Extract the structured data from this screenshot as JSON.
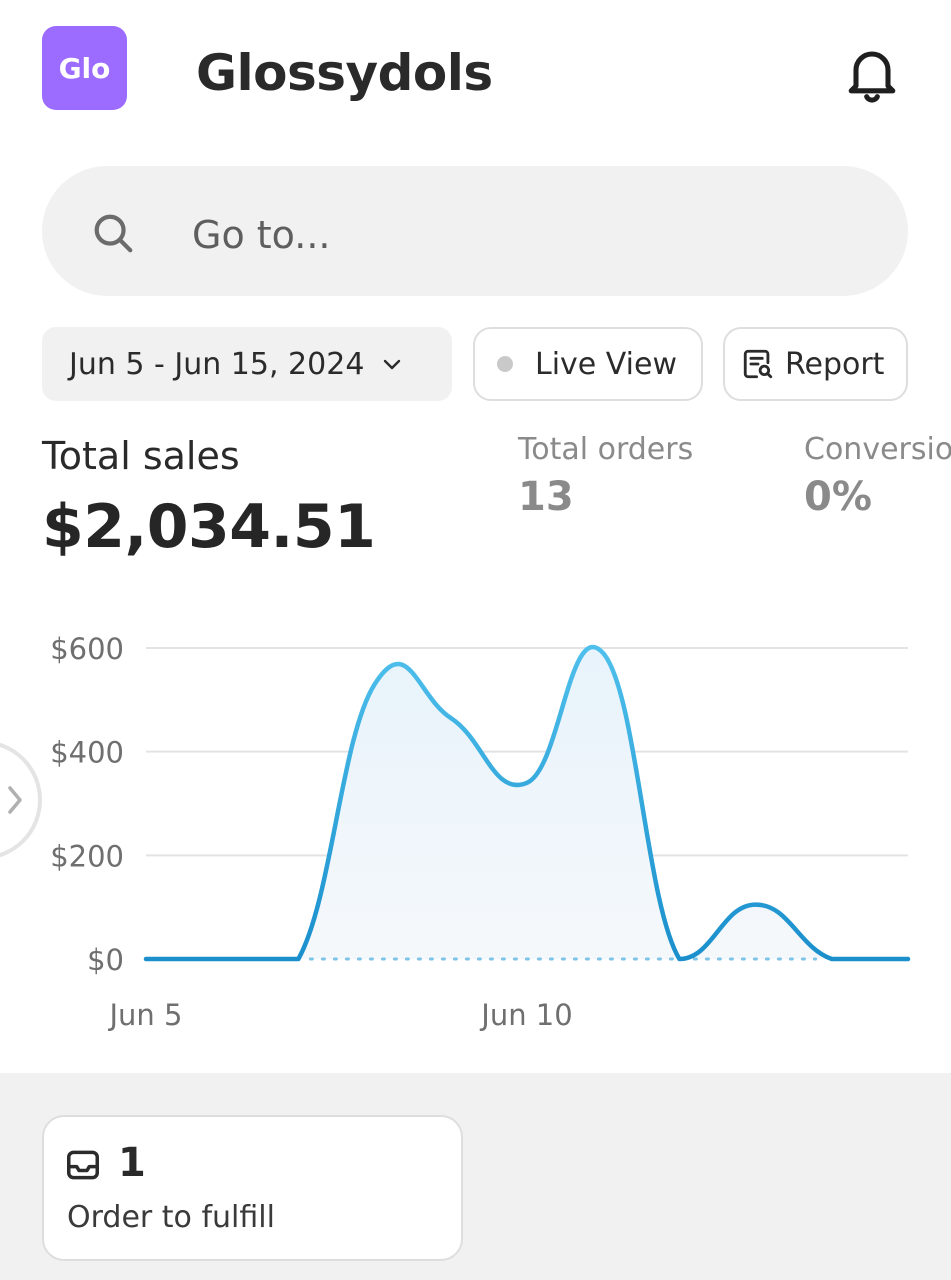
{
  "header": {
    "logo_text": "Glo",
    "store_name": "Glossydols",
    "logo_color": "#9b6cff",
    "bell_icon": "bell-icon"
  },
  "search": {
    "placeholder": "Go to...",
    "icon": "search-icon"
  },
  "filters": {
    "date_range": "Jun 5 - Jun 15, 2024",
    "live_view": "Live View",
    "report": "Report"
  },
  "metrics": {
    "total_sales_label": "Total sales",
    "total_sales_value": "$2,034.51",
    "total_orders_label": "Total orders",
    "total_orders_value": "13",
    "conversion_label": "Conversio",
    "conversion_value": "0%"
  },
  "chart_data": {
    "type": "line",
    "x_tick_labels": [
      "Jun 5",
      "Jun 10"
    ],
    "y_tick_labels": [
      "$0",
      "$200",
      "$400",
      "$600"
    ],
    "y_ticks": [
      0,
      200,
      400,
      600
    ],
    "ylim": [
      0,
      600
    ],
    "x": [
      "Jun 5",
      "Jun 6",
      "Jun 7",
      "Jun 8",
      "Jun 9",
      "Jun 10",
      "Jun 11",
      "Jun 12",
      "Jun 13",
      "Jun 14",
      "Jun 15"
    ],
    "series": [
      {
        "values": [
          0,
          0,
          0,
          530,
          465,
          340,
          590,
          0,
          105,
          0,
          0
        ],
        "color": "#3aaee0"
      }
    ],
    "grid": true
  },
  "fulfill": {
    "count": "1",
    "label": "Order to fulfill",
    "icon": "inbox-icon"
  }
}
